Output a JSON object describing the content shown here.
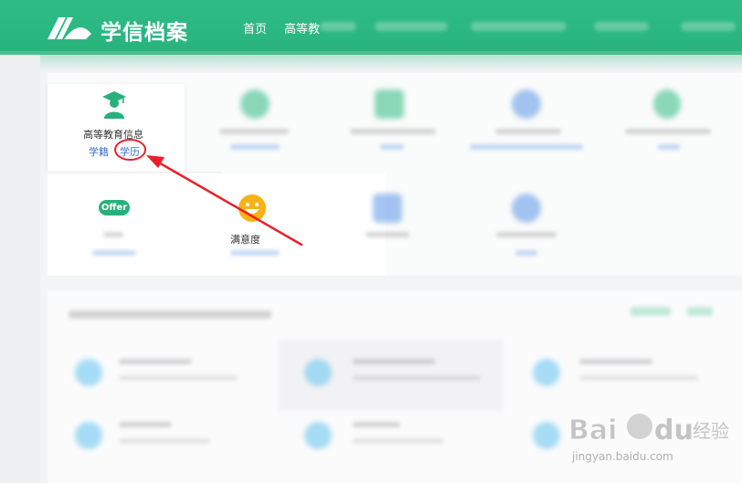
{
  "header": {
    "brand": "学信档案",
    "nav": [
      {
        "label": "首页"
      },
      {
        "label": "高等教"
      }
    ]
  },
  "card": {
    "tile": {
      "title": "高等教育信息",
      "links": [
        "学籍",
        "学历"
      ]
    },
    "offer_badge": "Offer",
    "survey_label": "满意度"
  },
  "colors": {
    "brand_green": "#2fbc86",
    "link_blue": "#3a6fd0",
    "annotation_red": "#e8212a"
  },
  "watermark": {
    "url": "jingyan.baidu.com"
  }
}
